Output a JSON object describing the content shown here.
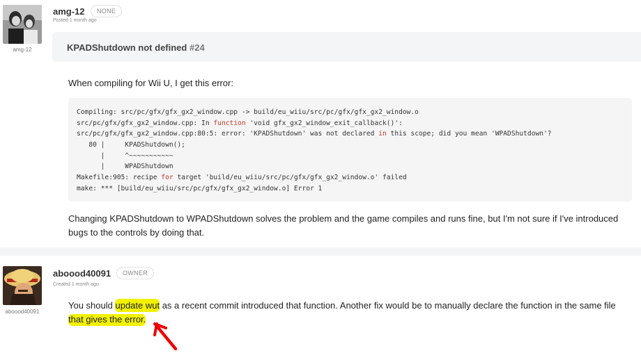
{
  "post1": {
    "username": "amg-12",
    "role": "NONE",
    "posted": "Posted 1 month ago",
    "avatar_caption": "amg-12",
    "title": "KPADShutdown not defined",
    "issue_number": "#24",
    "intro": "When compiling for Wii U, I get this error:",
    "code_lines": [
      [
        {
          "t": "Compiling: src/pc/gfx/gfx_gx2_window.cpp -> build/eu_wiiu/src/pc/gfx/gfx_gx2_window.o"
        }
      ],
      [
        {
          "t": "src/pc/gfx/gfx_gx2_window.cpp: In "
        },
        {
          "t": "function",
          "k": true
        },
        {
          "t": " 'void gfx_gx2_window_exit_callback()':"
        }
      ],
      [
        {
          "t": "src/pc/gfx/gfx_gx2_window.cpp:80:5: error: 'KPADShutdown' was not declared "
        },
        {
          "t": "in",
          "k": true
        },
        {
          "t": " this scope; did you mean 'WPADShutdown'?"
        }
      ],
      [
        {
          "t": "   80 |     KPADShutdown();"
        }
      ],
      [
        {
          "t": "      |     ^~~~~~~~~~~~"
        }
      ],
      [
        {
          "t": "      |     WPADShutdown"
        }
      ],
      [
        {
          "t": "Makefile:905: recipe "
        },
        {
          "t": "for",
          "k": true
        },
        {
          "t": " target 'build/eu_wiiu/src/pc/gfx/gfx_gx2_window.o' failed"
        }
      ],
      [
        {
          "t": "make: *** [build/eu_wiiu/src/pc/gfx/gfx_gx2_window.o] Error 1"
        }
      ]
    ],
    "closing_line1": "Changing KPADShutdown to WPADShutdown solves the problem and the game compiles and runs fine, but I'm not sure if I've introduced",
    "closing_line2": "bugs to the controls by doing that."
  },
  "post2": {
    "username": "aboood40091",
    "role": "OWNER",
    "created": "Created 1 month ago",
    "avatar_caption": "aboood40091",
    "reply_before": "You should ",
    "reply_highlight": "update wut",
    "reply_after": " as a recent commit introduced that function. Another fix would be to manually declare the function in the same file",
    "reply_line2": "that gives the error."
  },
  "colors": {
    "highlight": "#f2f200",
    "arrow": "#ee0000",
    "keyword": "#c0392b"
  },
  "icons": {
    "post1_avatar": "user-photo-avatar",
    "post2_avatar": "straw-hat-character-avatar",
    "annotation": "red-arrow"
  }
}
